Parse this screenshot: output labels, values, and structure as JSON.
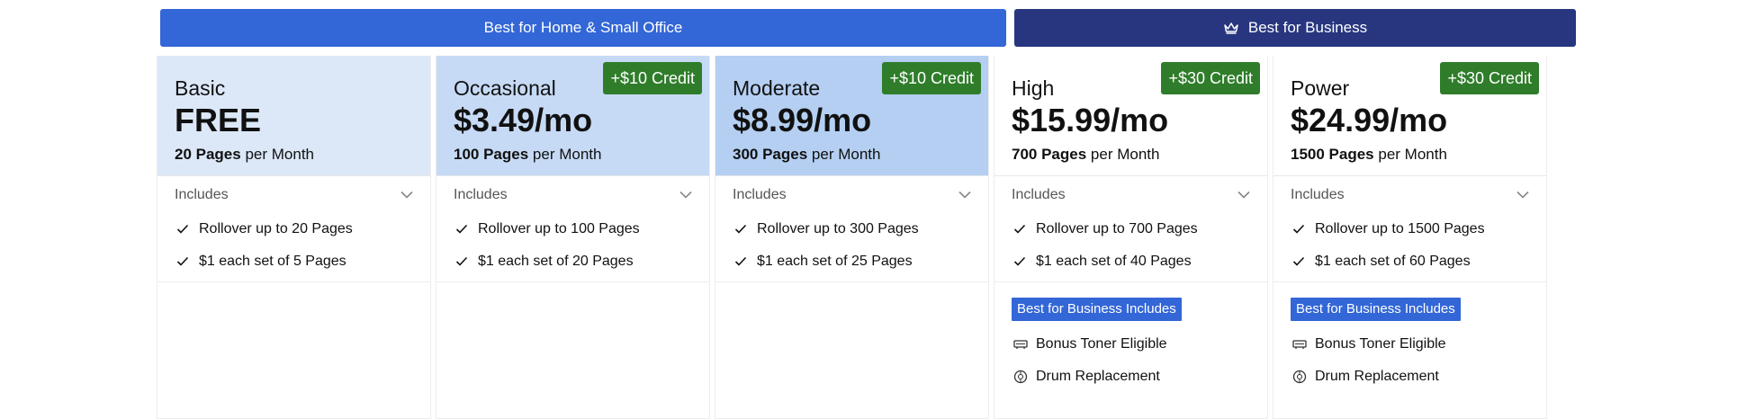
{
  "banners": {
    "home_label": "Best for Home & Small Office",
    "business_label": "Best for Business",
    "home_color": "#3366d6",
    "business_color": "#27367f"
  },
  "plans": [
    {
      "name": "Basic",
      "price": "FREE",
      "pages_bold": "20 Pages",
      "pages_suffix": " per Month",
      "credit": "",
      "includes_label": "Includes",
      "features": [
        "Rollover up to 20 Pages",
        "$1 each set of 5 Pages"
      ],
      "header_color": "#dce8f8"
    },
    {
      "name": "Occasional",
      "price": "$3.49/mo",
      "pages_bold": "100 Pages",
      "pages_suffix": " per Month",
      "credit": "+$10 Credit",
      "includes_label": "Includes",
      "features": [
        "Rollover up to 100 Pages",
        "$1 each set of 20 Pages"
      ],
      "header_color": "#c6daf5"
    },
    {
      "name": "Moderate",
      "price": "$8.99/mo",
      "pages_bold": "300 Pages",
      "pages_suffix": " per Month",
      "credit": "+$10 Credit",
      "includes_label": "Includes",
      "features": [
        "Rollover up to 300 Pages",
        "$1 each set of 25 Pages"
      ],
      "header_color": "#b4cff2"
    },
    {
      "name": "High",
      "price": "$15.99/mo",
      "pages_bold": "700 Pages",
      "pages_suffix": " per Month",
      "credit": "+$30 Credit",
      "includes_label": "Includes",
      "features": [
        "Rollover up to 700 Pages",
        "$1 each set of 40 Pages"
      ],
      "header_color": "#ffffff",
      "business_tag": "Best for Business Includes",
      "business_features": [
        "Bonus Toner Eligible",
        "Drum Replacement"
      ]
    },
    {
      "name": "Power",
      "price": "$24.99/mo",
      "pages_bold": "1500 Pages",
      "pages_suffix": " per Month",
      "credit": "+$30 Credit",
      "includes_label": "Includes",
      "features": [
        "Rollover up to 1500 Pages",
        "$1 each set of 60 Pages"
      ],
      "header_color": "#ffffff",
      "business_tag": "Best for Business Includes",
      "business_features": [
        "Bonus Toner Eligible",
        "Drum Replacement"
      ]
    }
  ],
  "icons": {
    "crown": "crown-icon",
    "chevron": "chevron-down-icon",
    "check": "check-icon",
    "toner": "toner-cartridge-icon",
    "drum": "drum-icon"
  },
  "colors": {
    "credit_badge": "#2f7d2a",
    "business_tag": "#3366d6"
  }
}
